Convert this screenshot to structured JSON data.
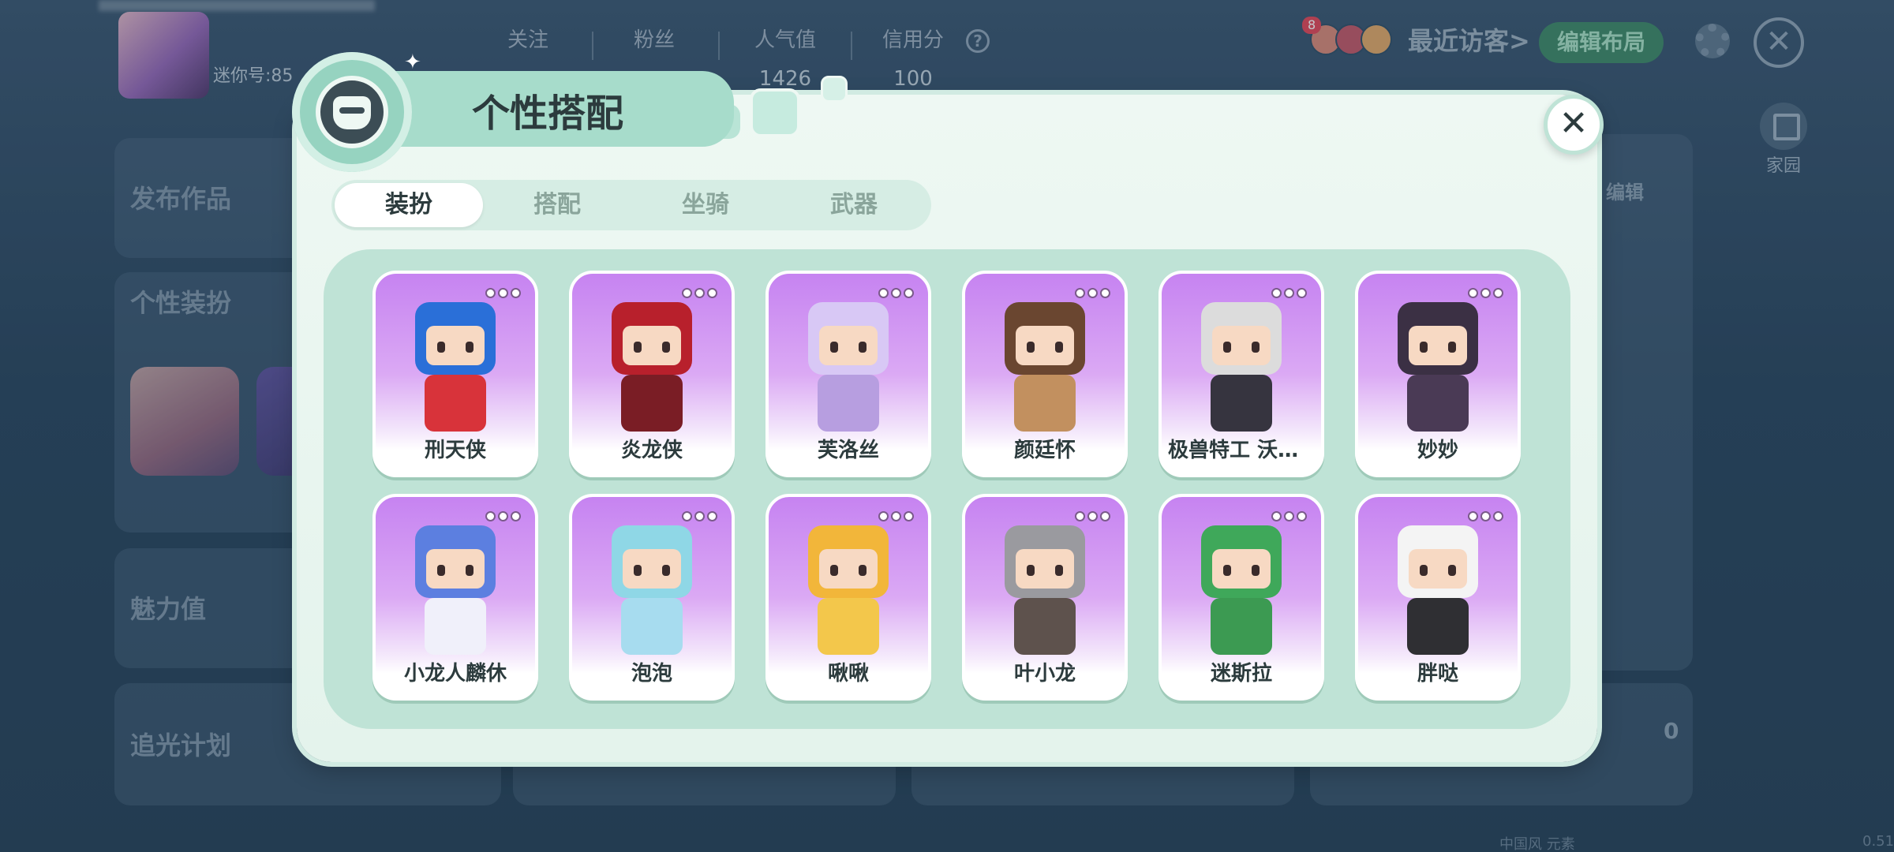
{
  "background": {
    "uid_label": "迷你号:85",
    "stats": [
      {
        "label": "关注",
        "value": ""
      },
      {
        "label": "粉丝",
        "value": ""
      },
      {
        "label": "人气值",
        "value": "1426"
      },
      {
        "label": "信用分",
        "value": "100"
      }
    ],
    "help_icon": "?",
    "visitors": {
      "badge": "8",
      "label": "最近访客>"
    },
    "edit_layout": "编辑布局",
    "home_label": "家园",
    "cards": {
      "publish": "发布作品",
      "dressup": "个性装扮",
      "charm": "魅力值",
      "chase": "追光计划"
    },
    "edit_label": "编辑",
    "zero_value": "0",
    "footer_text": "中国风 元素",
    "corner_text": "0.51"
  },
  "modal": {
    "title": "个性搭配",
    "close_symbol": "✕",
    "tabs": [
      {
        "label": "装扮",
        "active": true
      },
      {
        "label": "搭配",
        "active": false
      },
      {
        "label": "坐骑",
        "active": false
      },
      {
        "label": "武器",
        "active": false
      }
    ],
    "items": [
      {
        "name": "刑天侠",
        "hair": "#2a6fd8",
        "body": "#d8333a"
      },
      {
        "name": "炎龙侠",
        "hair": "#b8202c",
        "body": "#7a1d25"
      },
      {
        "name": "芙洛丝",
        "hair": "#d8c8f5",
        "body": "#b79ee0"
      },
      {
        "name": "颜廷怀",
        "hair": "#6a4630",
        "body": "#c2905f"
      },
      {
        "name": "极兽特工 沃夫...",
        "hair": "#dcdcdc",
        "body": "#36343f"
      },
      {
        "name": "妙妙",
        "hair": "#3b3044",
        "body": "#4a3a55"
      },
      {
        "name": "小龙人麟休",
        "hair": "#5c7fe0",
        "body": "#f0f0fa"
      },
      {
        "name": "泡泡",
        "hair": "#8fd7e6",
        "body": "#a7dcef"
      },
      {
        "name": "啾啾",
        "hair": "#f2b63a",
        "body": "#f3c74b"
      },
      {
        "name": "叶小龙",
        "hair": "#9a9a9f",
        "body": "#5e524d"
      },
      {
        "name": "迷斯拉",
        "hair": "#3fa85a",
        "body": "#3c9a52"
      },
      {
        "name": "胖哒",
        "hair": "#f4f4f4",
        "body": "#2f2f33"
      }
    ]
  }
}
